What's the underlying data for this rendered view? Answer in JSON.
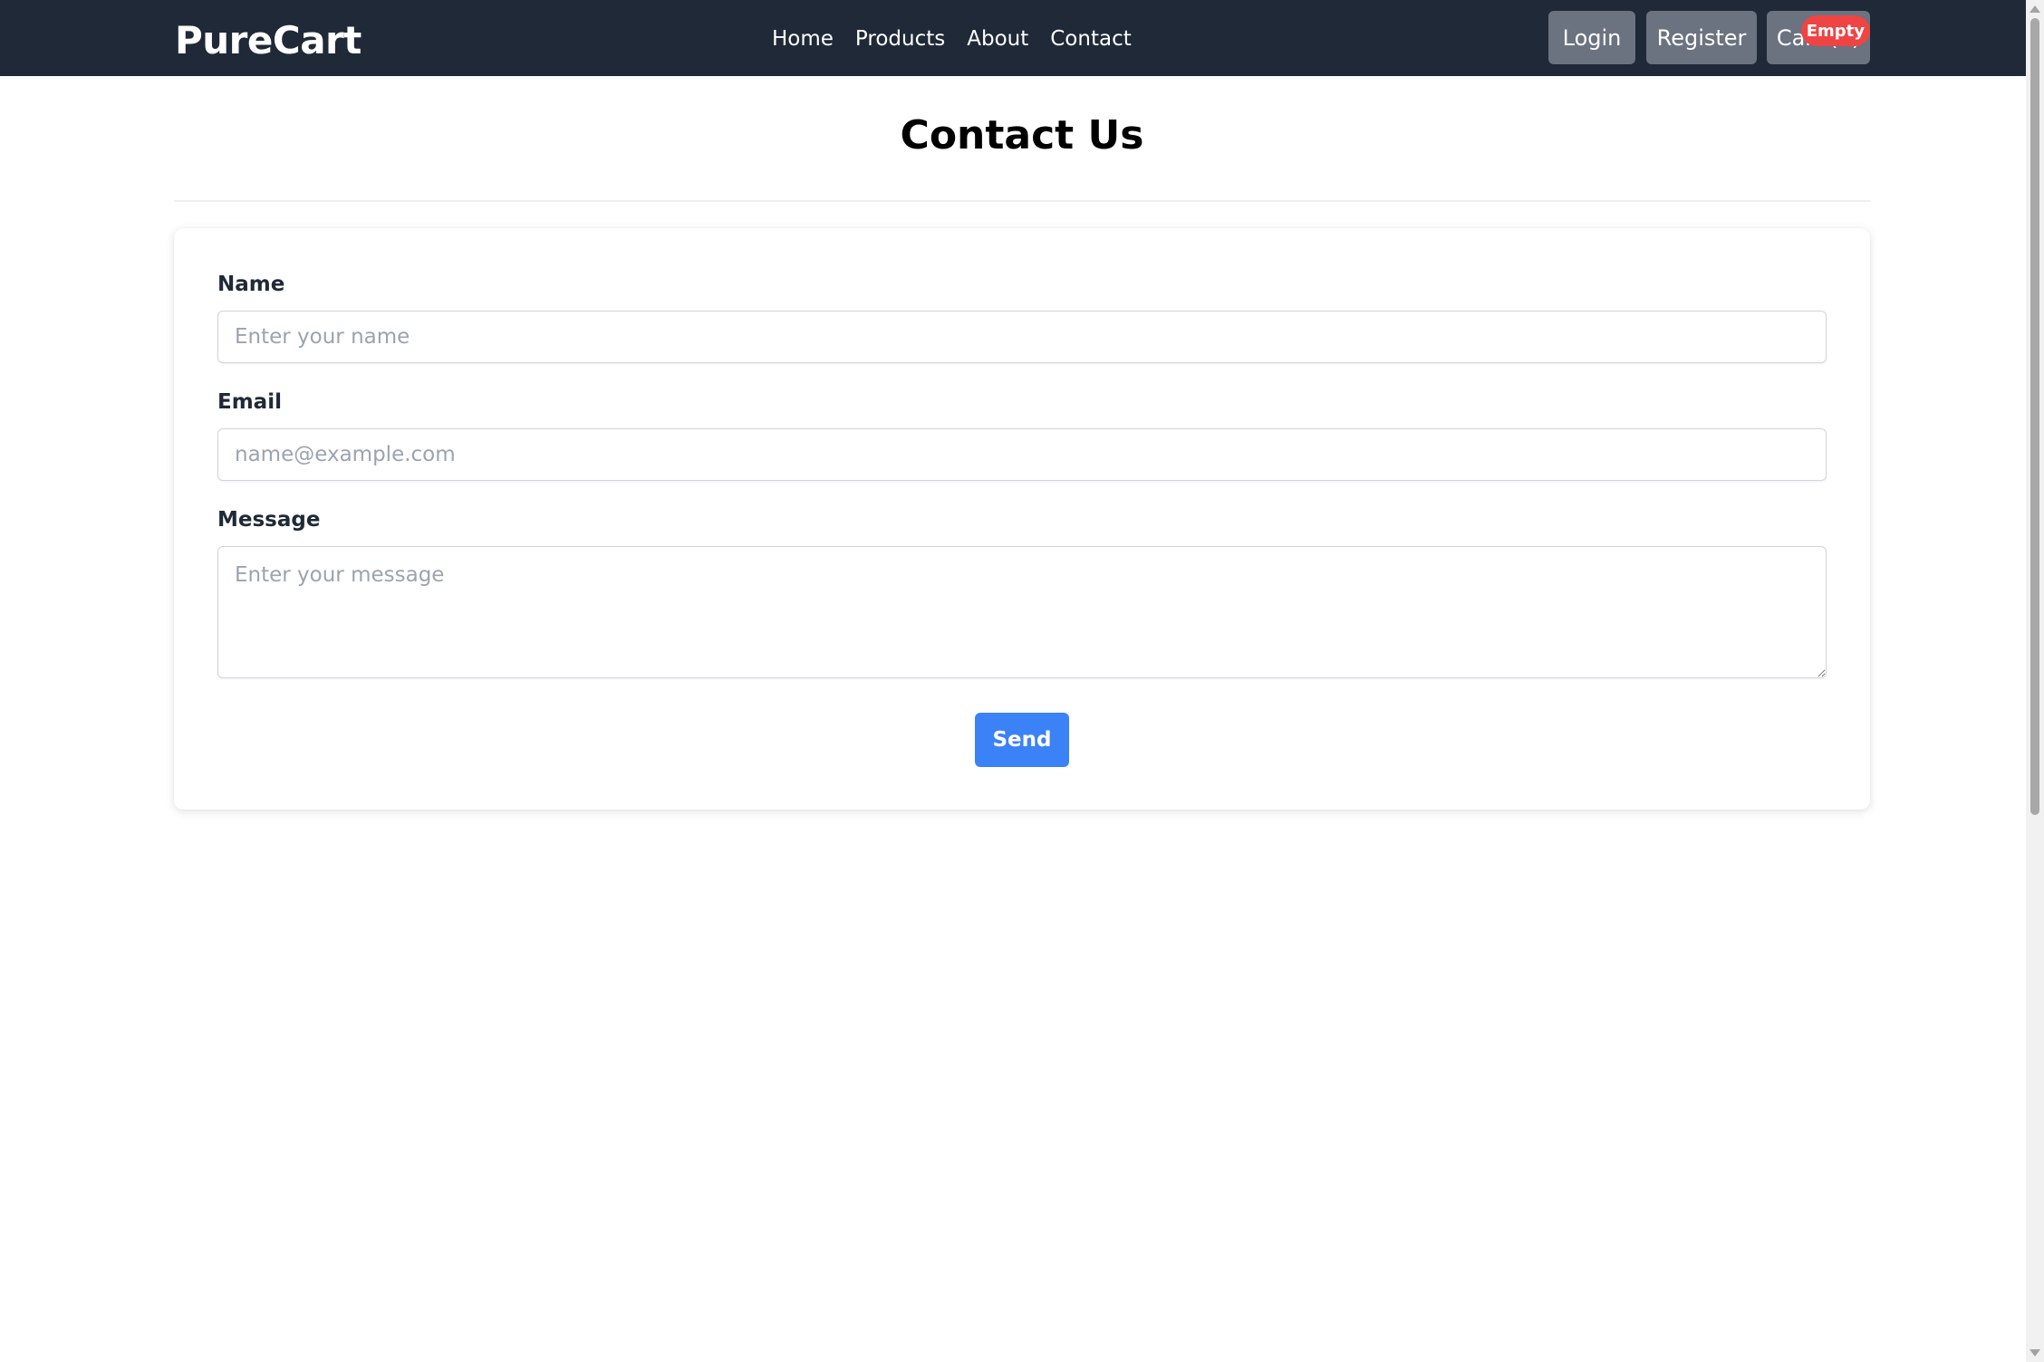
{
  "navbar": {
    "brand": "PureCart",
    "links": [
      "Home",
      "Products",
      "About",
      "Contact"
    ],
    "login_label": "Login",
    "register_label": "Register",
    "cart_label": "Cart (0)",
    "cart_badge": "Empty"
  },
  "page": {
    "title": "Contact Us"
  },
  "form": {
    "name_label": "Name",
    "name_placeholder": "Enter your name",
    "email_label": "Email",
    "email_placeholder": "name@example.com",
    "message_label": "Message",
    "message_placeholder": "Enter your message",
    "send_label": "Send"
  },
  "colors": {
    "navbar_bg": "#1f2937",
    "nav_button_bg": "#6b7280",
    "badge_bg": "#ef4444",
    "primary": "#3b82f6"
  }
}
